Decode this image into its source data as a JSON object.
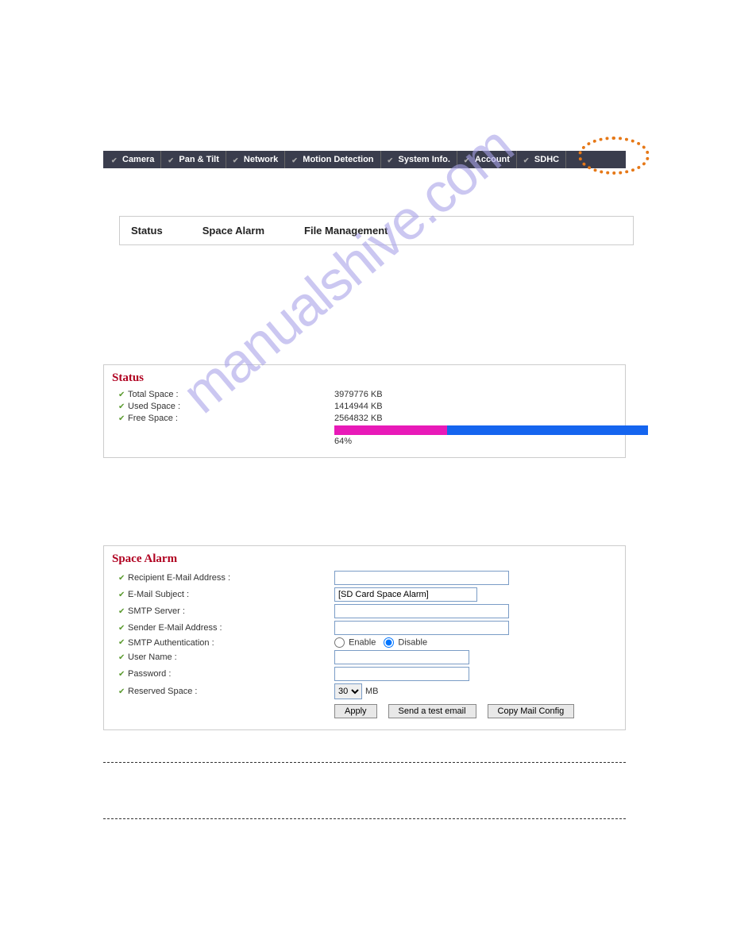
{
  "watermark": "manualshive.com",
  "nav": {
    "items": [
      "Camera",
      "Pan & Tilt",
      "Network",
      "Motion Detection",
      "System Info.",
      "Account",
      "SDHC"
    ]
  },
  "subtabs": [
    "Status",
    "Space Alarm",
    "File Management"
  ],
  "status": {
    "title": "Status",
    "total_label": "Total Space :",
    "total_value": "3979776 KB",
    "used_label": "Used Space :",
    "used_value": "1414944 KB",
    "free_label": "Free Space :",
    "free_value": "2564832 KB",
    "percent_label": "64%",
    "used_pct": 36,
    "free_pct": 64
  },
  "alarm": {
    "title": "Space Alarm",
    "recipient_label": "Recipient E-Mail Address :",
    "recipient_value": "",
    "subject_label": "E-Mail Subject :",
    "subject_value": "[SD Card Space Alarm]",
    "smtp_label": "SMTP Server :",
    "smtp_value": "",
    "sender_label": "Sender E-Mail Address :",
    "sender_value": "",
    "auth_label": "SMTP Authentication :",
    "auth_enable": "Enable",
    "auth_disable": "Disable",
    "user_label": "User Name :",
    "user_value": "",
    "pass_label": "Password :",
    "pass_value": "",
    "reserved_label": "Reserved Space :",
    "reserved_value": "30",
    "reserved_unit": "MB",
    "btn_apply": "Apply",
    "btn_test": "Send a test email",
    "btn_copy": "Copy Mail Config"
  }
}
